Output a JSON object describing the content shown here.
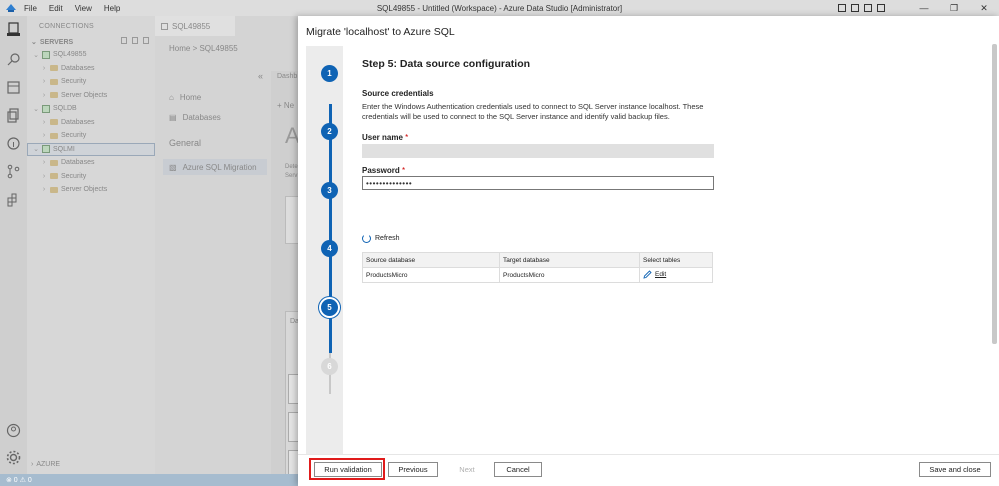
{
  "window": {
    "title": "SQL49855 - Untitled (Workspace) - Azure Data Studio [Administrator]",
    "menu": [
      "File",
      "Edit",
      "View",
      "Help"
    ]
  },
  "sidebar": {
    "header": "CONNECTIONS",
    "section": "SERVERS",
    "servers": [
      {
        "name": "SQL49855",
        "children": [
          "Databases",
          "Security",
          "Server Objects"
        ]
      },
      {
        "name": "SQLDB",
        "children": [
          "Databases",
          "Security"
        ]
      },
      {
        "name": "SQLMI",
        "children": [
          "Databases",
          "Security",
          "Server Objects"
        ]
      }
    ],
    "footer_section": "AZURE"
  },
  "editor": {
    "tab_label": "SQL49855",
    "breadcrumb": "Home  >  SQL49855",
    "nav_home": "Home",
    "nav_databases": "Databases",
    "nav_general": "General",
    "nav_migration": "Azure SQL Migration",
    "dashboard_tab": "Dashb",
    "new_label": "+ Ne",
    "big_letter": "A",
    "detect_text": "Dete",
    "serv_text": "Serv",
    "da_text": "Da"
  },
  "status": {
    "text": "⊗ 0 ⚠ 0"
  },
  "dialog": {
    "title": "Migrate 'localhost' to Azure SQL",
    "steps": [
      "1",
      "2",
      "3",
      "4",
      "5",
      "6"
    ],
    "current_step": 5,
    "step_title": "Step 5: Data source configuration",
    "section_title": "Source credentials",
    "description": "Enter the Windows Authentication credentials used to connect to SQL Server instance localhost. These credentials will be used to connect to the SQL Server instance and identify valid backup files.",
    "username_label": "User name",
    "username_value": "",
    "password_label": "Password",
    "password_value": "••••••••••••••",
    "required_marker": "*",
    "refresh_label": "Refresh",
    "table": {
      "headers": [
        "Source database",
        "Target database",
        "Select tables"
      ],
      "rows": [
        {
          "source": "ProductsMicro",
          "target": "ProductsMicro",
          "action": "Edit"
        }
      ]
    },
    "footer": {
      "run_validation": "Run validation",
      "previous": "Previous",
      "next": "Next",
      "cancel": "Cancel",
      "save_close": "Save and close"
    }
  }
}
